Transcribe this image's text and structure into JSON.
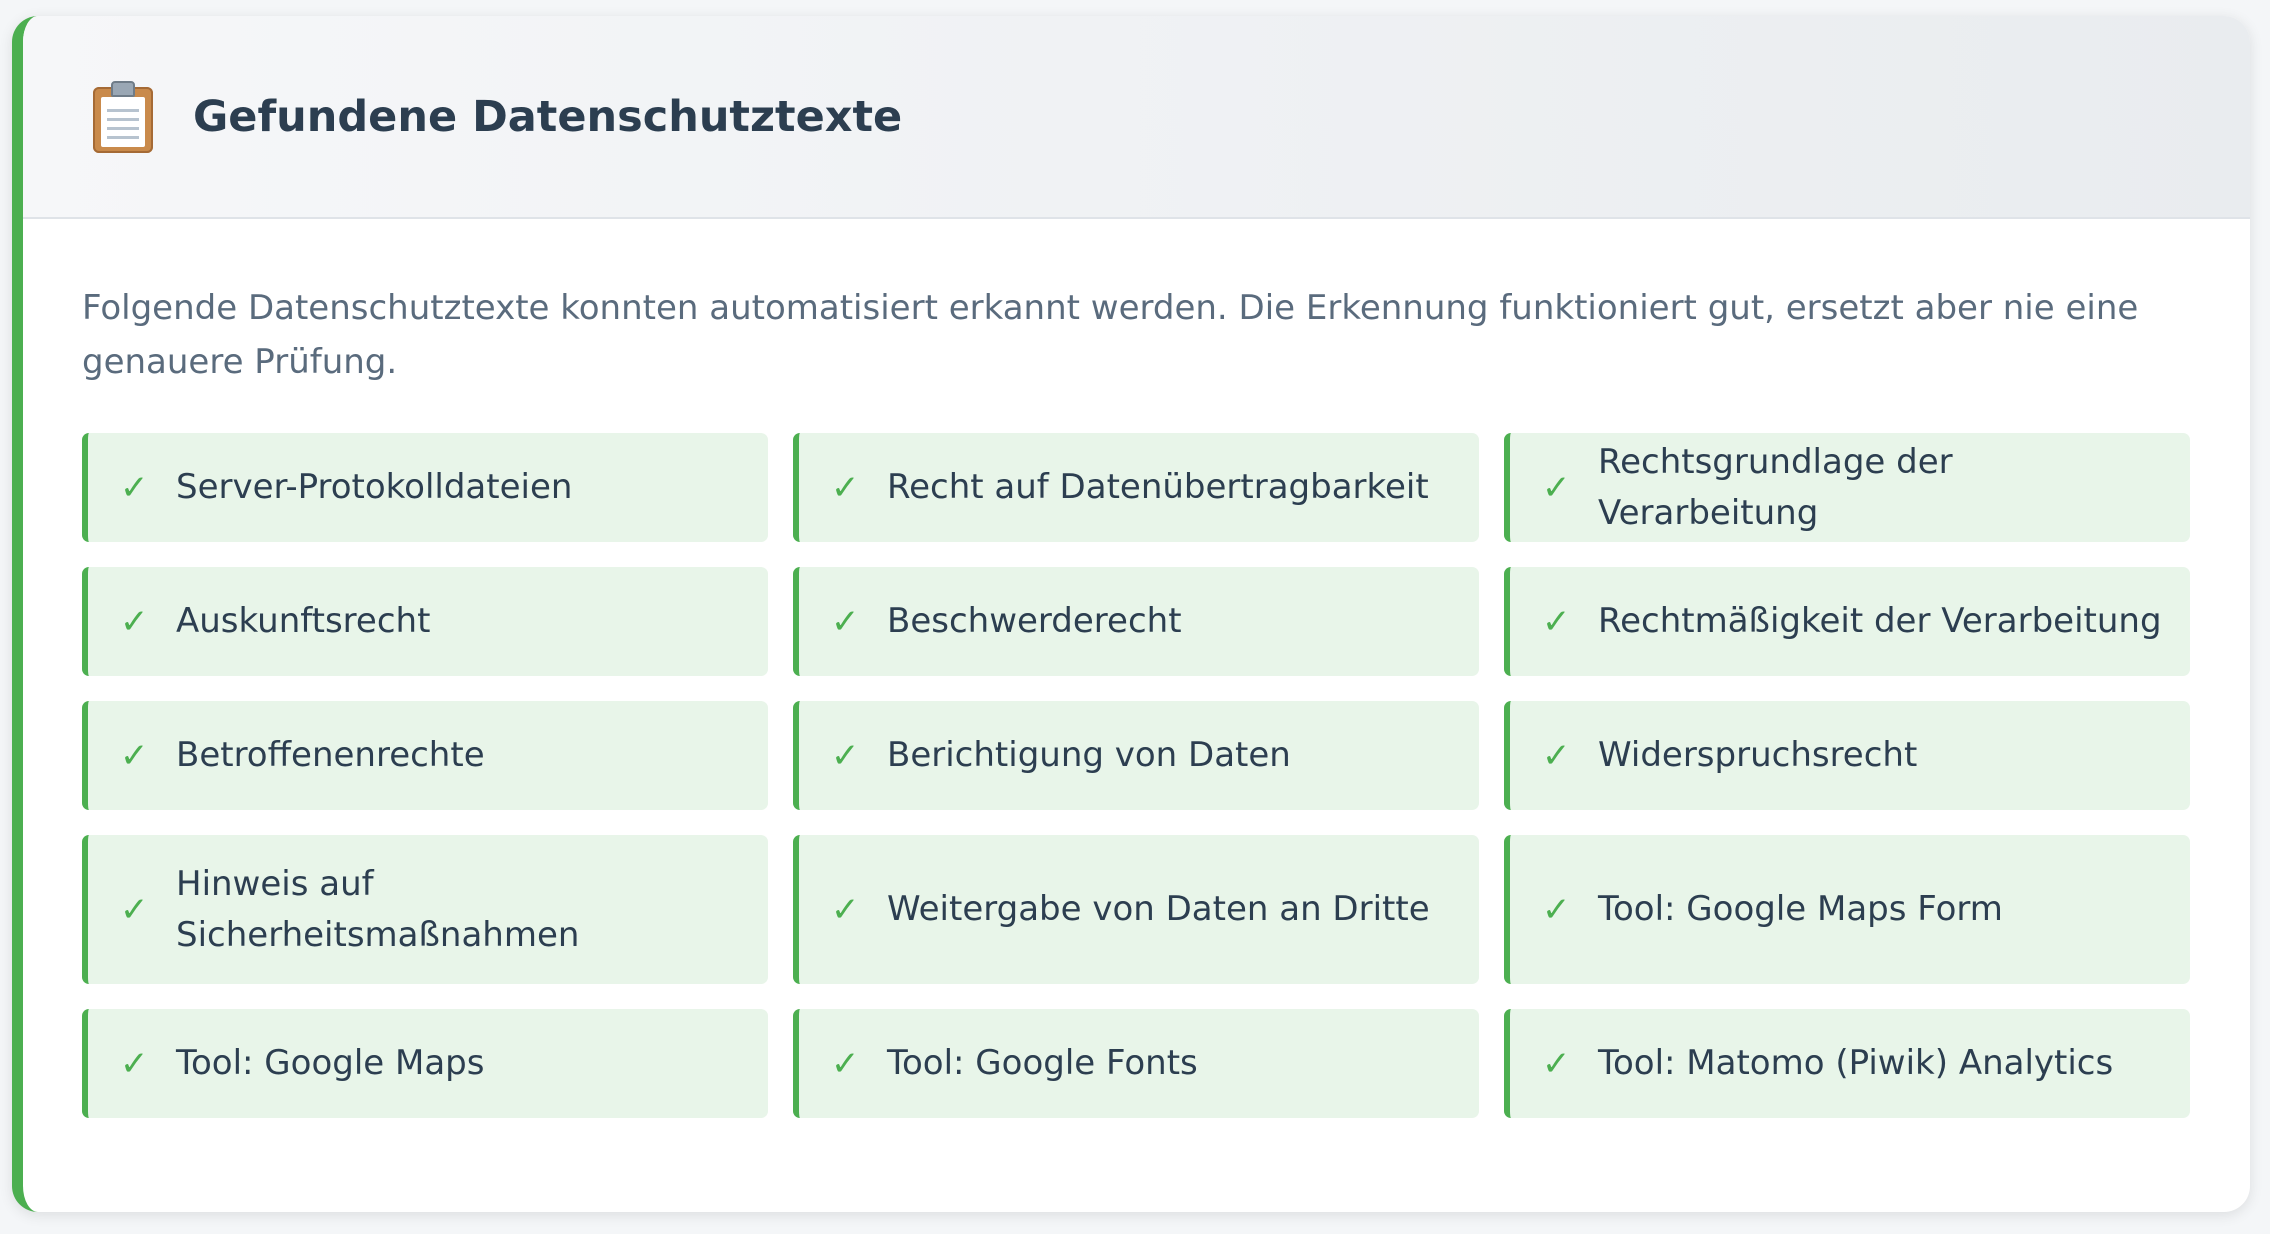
{
  "header": {
    "icon": "clipboard-icon",
    "title": "Gefundene Datenschutztexte"
  },
  "description": "Folgende Datenschutztexte konnten automatisiert erkannt werden. Die Erkennung funktioniert gut, ersetzt aber nie eine genauere Prüfung.",
  "colors": {
    "accent": "#4caf50",
    "item_background": "#e8f5e9",
    "title_text": "#2c3e50",
    "description_text": "#5a6b7d"
  },
  "check_symbol": "✓",
  "items": [
    {
      "label": "Server-Protokolldateien"
    },
    {
      "label": "Recht auf Datenübertragbarkeit"
    },
    {
      "label": "Rechtsgrundlage der Verarbeitung"
    },
    {
      "label": "Auskunftsrecht"
    },
    {
      "label": "Beschwerderecht"
    },
    {
      "label": "Rechtmäßigkeit der Verarbeitung"
    },
    {
      "label": "Betroffenenrechte"
    },
    {
      "label": "Berichtigung von Daten"
    },
    {
      "label": "Widerspruchsrecht"
    },
    {
      "label": "Hinweis auf Sicherheitsmaßnahmen"
    },
    {
      "label": "Weitergabe von Daten an Dritte"
    },
    {
      "label": "Tool: Google Maps Form"
    },
    {
      "label": "Tool: Google Maps"
    },
    {
      "label": "Tool: Google Fonts"
    },
    {
      "label": "Tool: Matomo (Piwik) Analytics"
    }
  ]
}
